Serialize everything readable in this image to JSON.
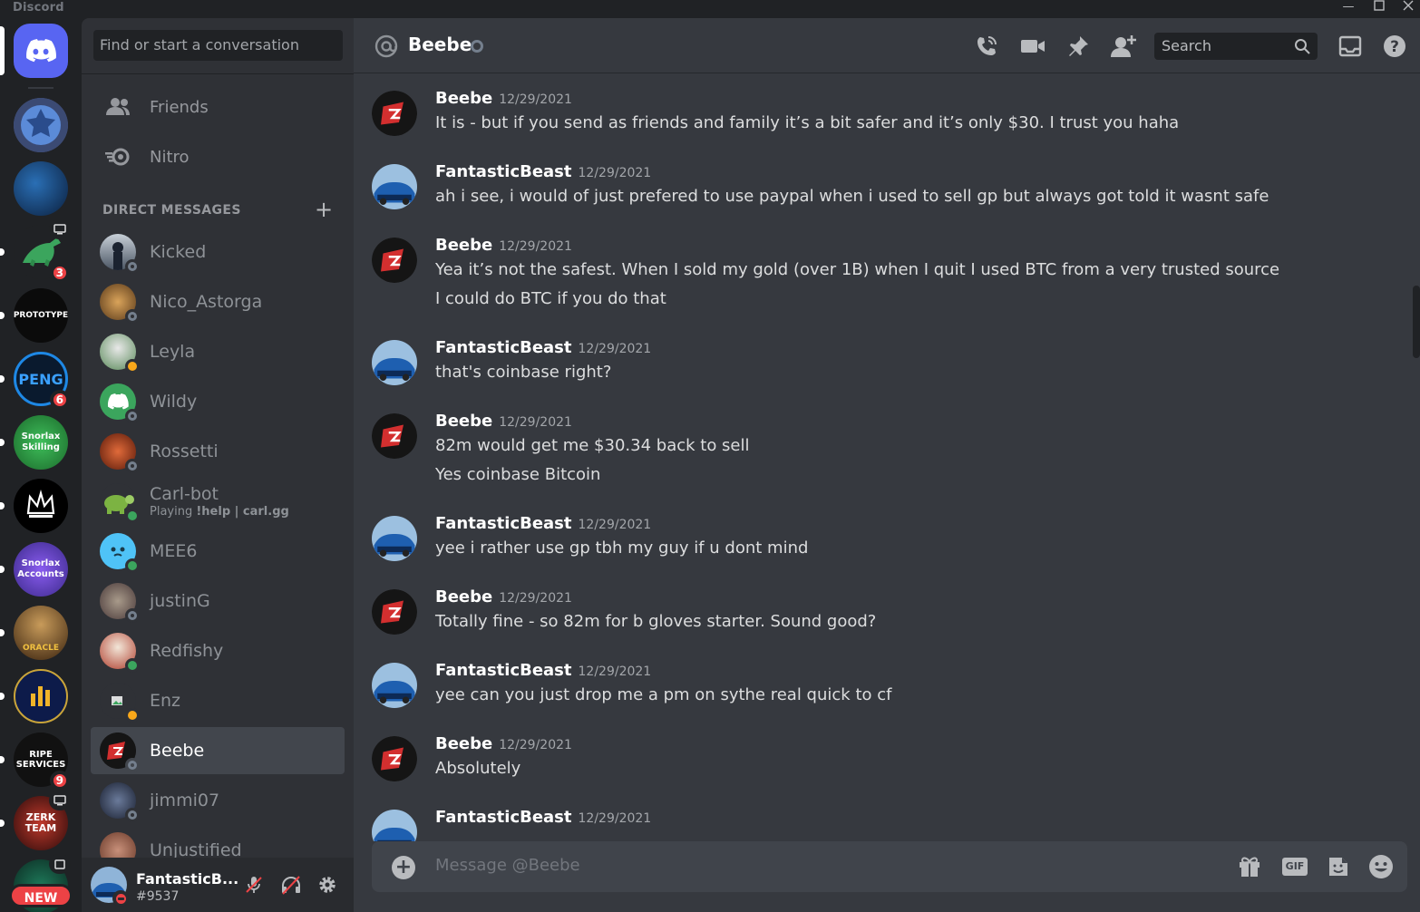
{
  "window": {
    "title": "Discord"
  },
  "search_dm": {
    "placeholder": "Find or start a conversation"
  },
  "nav": {
    "friends": "Friends",
    "nitro": "Nitro"
  },
  "dm_section": {
    "header": "DIRECT MESSAGES"
  },
  "guilds": {
    "badges": {
      "dino": "3",
      "peng": "6",
      "ripe": "9"
    },
    "labels": {
      "prototype": "PROTOTYPE",
      "peng": "PENG",
      "snorlax_skilling": "Snorlax Skilling",
      "snorlax_accounts": "Snorlax Accounts",
      "oracle": "ORACLE",
      "ripe": "RIPE SERVICES",
      "zerk": "ZERK TEAM"
    },
    "new_label": "NEW"
  },
  "dms": [
    {
      "name": "Kicked"
    },
    {
      "name": "Nico_Astorga"
    },
    {
      "name": "Leyla"
    },
    {
      "name": "Wildy"
    },
    {
      "name": "Rossetti"
    },
    {
      "name": "Carl-bot",
      "activity_prefix": "Playing ",
      "activity": "!help | carl.gg"
    },
    {
      "name": "MEE6"
    },
    {
      "name": "justinG"
    },
    {
      "name": "Redfishy"
    },
    {
      "name": "Enz"
    },
    {
      "name": "Beebe"
    },
    {
      "name": "jimmi07"
    },
    {
      "name": "Unjustified"
    }
  ],
  "user": {
    "name": "FantasticB...",
    "tag": "#9537"
  },
  "chat": {
    "channel": "Beebe",
    "search_placeholder": "Search",
    "composer_placeholder": "Message @Beebe",
    "gif_label": "GIF"
  },
  "messages": [
    {
      "author": "Beebe",
      "time": "12/29/2021",
      "lines": [
        "It is - but if you send as friends and family it’s a bit safer and it’s only $30. I trust you haha"
      ]
    },
    {
      "author": "FantasticBeast",
      "time": "12/29/2021",
      "lines": [
        "ah i see, i would of just prefered to use paypal when i used to sell gp but always got told it wasnt safe"
      ]
    },
    {
      "author": "Beebe",
      "time": "12/29/2021",
      "lines": [
        "Yea it’s not the safest. When I sold my gold (over 1B) when I quit I used BTC from a very trusted source",
        "I could do BTC if you do that"
      ]
    },
    {
      "author": "FantasticBeast",
      "time": "12/29/2021",
      "lines": [
        "that's coinbase right?"
      ]
    },
    {
      "author": "Beebe",
      "time": "12/29/2021",
      "lines": [
        "82m would get me $30.34 back to sell",
        "Yes coinbase Bitcoin"
      ]
    },
    {
      "author": "FantasticBeast",
      "time": "12/29/2021",
      "lines": [
        "yee i rather use gp tbh my guy if u dont mind"
      ]
    },
    {
      "author": "Beebe",
      "time": "12/29/2021",
      "lines": [
        "Totally fine - so 82m for b gloves starter. Sound good?"
      ]
    },
    {
      "author": "FantasticBeast",
      "time": "12/29/2021",
      "lines": [
        "yee can you just drop me a pm on sythe real quick to cf"
      ]
    },
    {
      "author": "Beebe",
      "time": "12/29/2021",
      "lines": [
        "Absolutely"
      ]
    },
    {
      "author": "FantasticBeast",
      "time": "12/29/2021",
      "lines": []
    }
  ],
  "colors": {
    "blurple": "#5865f2",
    "online": "#3ba55d",
    "idle": "#faa81a",
    "dnd": "#ed4245",
    "offline": "#747f8d"
  }
}
